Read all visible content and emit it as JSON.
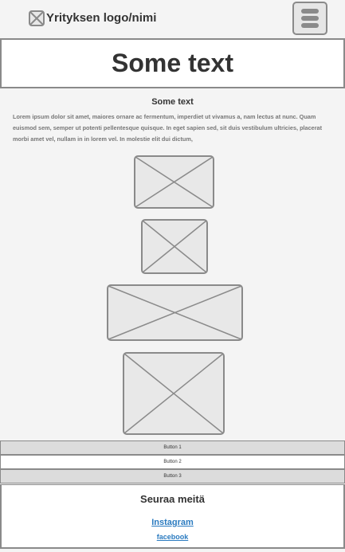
{
  "header": {
    "brand": "Yrityksen logo/nimi",
    "logo_icon": "image-placeholder-icon",
    "menu_icon": "hamburger-menu-icon"
  },
  "hero": {
    "title": "Some text"
  },
  "content": {
    "title": "Some text",
    "paragraph": "Lorem ipsum dolor sit amet, maiores ornare ac fermentum, imperdiet ut vivamus a, nam lectus at nunc. Quam euismod sem, semper ut potenti pellentesque quisque. In eget sapien sed, sit duis vestibulum ultricies, placerat morbi amet vel, nullam in in lorem vel. In molestie elit dui dictum,"
  },
  "buttons": [
    {
      "label": "Button 1"
    },
    {
      "label": "Button 2"
    },
    {
      "label": "Button 3"
    }
  ],
  "footer": {
    "title": "Seuraa meitä",
    "link_instagram": "Instagram",
    "link_facebook": "facebook"
  },
  "colors": {
    "background": "#f4f4f4",
    "border": "#8a8a8a",
    "placeholder_fill": "#e8e8e8",
    "link": "#2b7bc0"
  }
}
